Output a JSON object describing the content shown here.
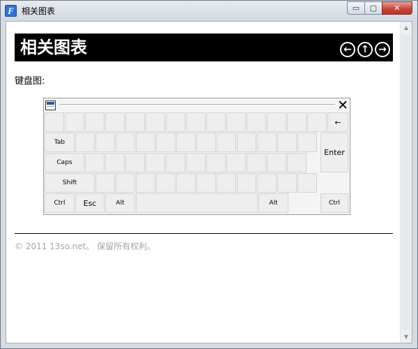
{
  "window": {
    "title": "相关图表",
    "app_icon_glyph": "F",
    "controls": {
      "minimize": "▭",
      "maximize": "▢",
      "close": "✕"
    }
  },
  "header": {
    "title": "相关图表",
    "nav": {
      "back": "←",
      "up": "↑",
      "forward": "→"
    }
  },
  "content": {
    "label": "键盘图:"
  },
  "keyboard": {
    "close_glyph": "✕",
    "keys": {
      "backspace": "←",
      "tab": "Tab",
      "caps": "Caps",
      "shift": "Shift",
      "enter": "Enter",
      "ctrl_left": "Ctrl",
      "esc": "Esc",
      "alt_left": "Alt",
      "space": "",
      "alt_right": "Alt",
      "ctrl_right": "Ctrl"
    }
  },
  "footer": {
    "text": "© 2011 13so.net。 保留所有权利。"
  },
  "scrollbar": {
    "up": "▲",
    "down": "▼"
  },
  "colors": {
    "header_bg": "#000000",
    "key_bg": "#eeeeee",
    "footer_text": "#a4a4a4",
    "close_button": "#c8453a"
  }
}
